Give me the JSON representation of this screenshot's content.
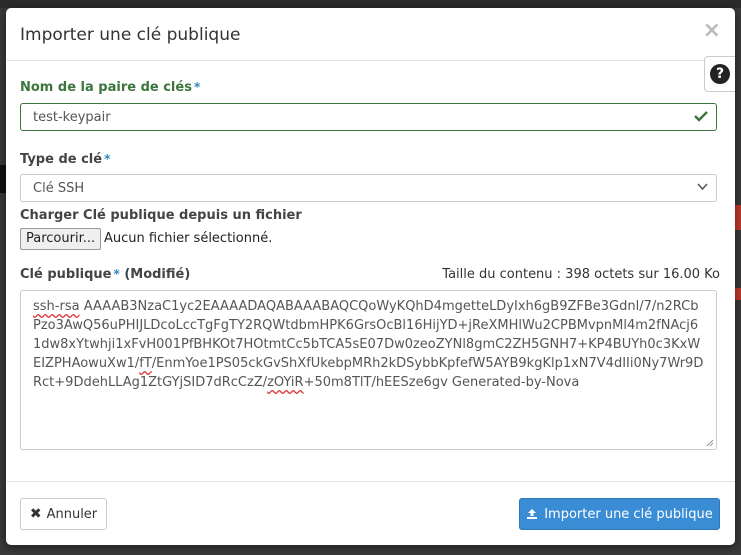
{
  "modal": {
    "title": "Importer une clé publique",
    "close_glyph": "×",
    "help_glyph": "?"
  },
  "keypair_name": {
    "label": "Nom de la paire de clés",
    "required_marker": "*",
    "value": "test-keypair"
  },
  "key_type": {
    "label": "Type de clé",
    "required_marker": "*",
    "selected": "Clé SSH"
  },
  "file_upload": {
    "label": "Charger Clé publique depuis un fichier",
    "button_label": "Parcourir...",
    "status": "Aucun fichier sélectionné."
  },
  "public_key": {
    "label": "Clé publique",
    "required_marker": "*",
    "modified": "(Modifié)",
    "size_info": "Taille du contenu : 398 octets sur 16.00 Ko",
    "content_prefix": "ssh-rsa",
    "content_part1": " AAAAB3NzaC1yc2EAAAADAQABAAABAQCQoWyKQhD4mgetteLDyIxh6gB9ZFBe3Gdnl/7/n2RCbPzo3AwQ56uPHIJLDcoLccTgFgTY2RQWtdbmHPK6GrsOcBl16HijYD+jReXMHlWu2CPBMvpnMl4m2fNAcj61dw8xYtwhji1xFvH001PfBHKOt7HOtmtCc5bTCA5sE07Dw0zeoZYNl8gmC2ZH5GNH7+KP4BUYh0c3KxWEIZPHAowuXw1/",
    "content_mid1": "fT",
    "content_part2": "/EnmYoe1PS05ckGvShXfUkebpMRh2kDSybbKpfefW5AYB9kgKlp1xN7V4dIIi0Ny7Wr9DRct+9DdehLLAg1ZtGYjSID7dRcCzZ/",
    "content_mid2": "zOYiR",
    "content_part3": "+50m8TlT/hEESze6gv Generated-by-Nova"
  },
  "footer": {
    "cancel_label": "Annuler",
    "import_label": "Importer une clé publique"
  },
  "colors": {
    "success": "#3c763d",
    "primary": "#3a8dd4",
    "required": "#2a87c9"
  }
}
